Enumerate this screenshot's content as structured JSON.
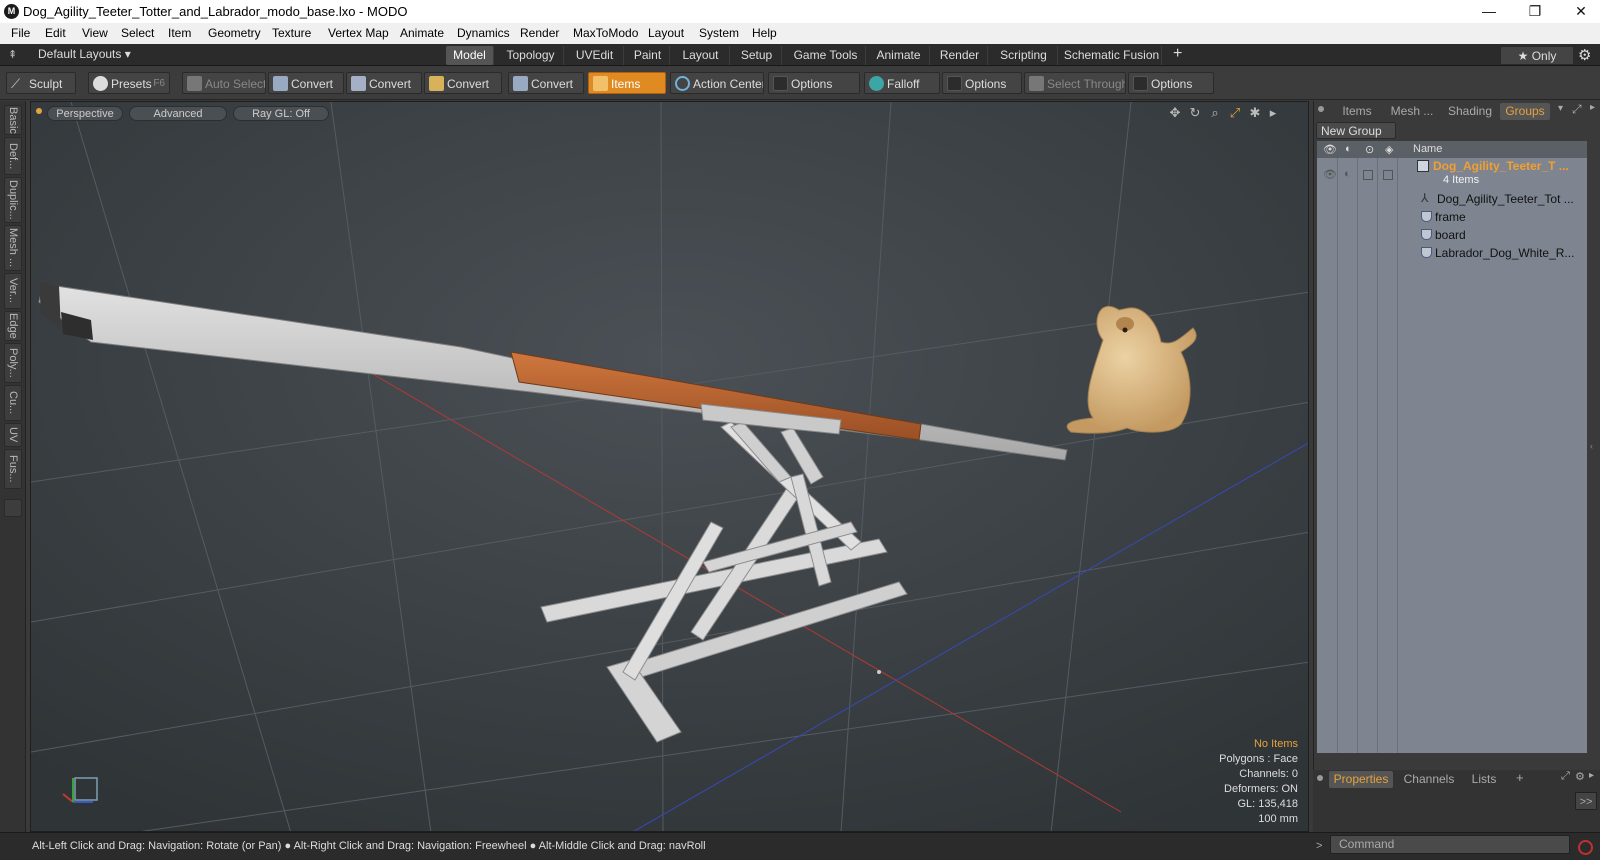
{
  "window": {
    "title": "Dog_Agility_Teeter_Totter_and_Labrador_modo_base.lxo - MODO",
    "app_icon_glyph": "M",
    "minimize": "—",
    "restore": "❐",
    "close": "✕"
  },
  "menu": [
    "File",
    "Edit",
    "View",
    "Select",
    "Item",
    "Geometry",
    "Texture",
    "Vertex Map",
    "Animate",
    "Dynamics",
    "Render",
    "MaxToModo",
    "Layout",
    "System",
    "Help"
  ],
  "layout_tabs": {
    "default_layouts": "Default Layouts ▾",
    "tabs": [
      "Model",
      "Topology",
      "UVEdit",
      "Paint",
      "Layout",
      "Setup",
      "Game Tools",
      "Animate",
      "Render",
      "Scripting",
      "Schematic Fusion"
    ],
    "active": "Model",
    "add": "+",
    "only": "★  Only",
    "gear": "⚙"
  },
  "toolbar": {
    "sculpt": "Sculpt",
    "presets": "Presets",
    "presets_key": "F6",
    "auto_select": "Auto Select",
    "convert": "Convert",
    "items": "Items",
    "action_center": "Action Center",
    "options": "Options",
    "falloff": "Falloff",
    "select_through": "Select Through",
    "accent": "#e08a22"
  },
  "left_tabs": [
    "Basic",
    "Def...",
    "Duplic...",
    "Mesh ...",
    "Ver...",
    "Edge",
    "Poly...",
    "Cu...",
    "UV",
    "Fus..."
  ],
  "viewport": {
    "view_mode": "Perspective",
    "shading": "Advanced",
    "raygl": "Ray GL: Off",
    "icons": [
      "move-icon",
      "rotate-icon",
      "zoom-icon",
      "fit-icon",
      "settings-icon",
      "arrow-icon"
    ],
    "info": {
      "selection": "No Items",
      "polygons": "Polygons : Face",
      "channels": "Channels: 0",
      "deformers": "Deformers: ON",
      "gl": "GL: 135,418",
      "unit": "100 mm"
    }
  },
  "right_panel": {
    "tabs": [
      "Items",
      "Mesh ...",
      "Shading",
      "Groups"
    ],
    "active": "Groups",
    "new_group": "New Group",
    "name_header": "Name",
    "group": {
      "name": "Dog_Agility_Teeter_T ...",
      "count": "4 Items"
    },
    "items": [
      "Dog_Agility_Teeter_Tot ...",
      "frame",
      "board",
      "Labrador_Dog_White_R..."
    ],
    "bottom_tabs": [
      "Properties",
      "Channels",
      "Lists"
    ],
    "bottom_active": "Properties",
    "add": "+",
    "expand": ">>"
  },
  "status": {
    "hint": "Alt-Left Click and Drag: Navigation: Rotate (or Pan) ● Alt-Right Click and Drag: Navigation: Freewheel ● Alt-Middle Click and Drag: navRoll",
    "command_placeholder": "Command"
  }
}
